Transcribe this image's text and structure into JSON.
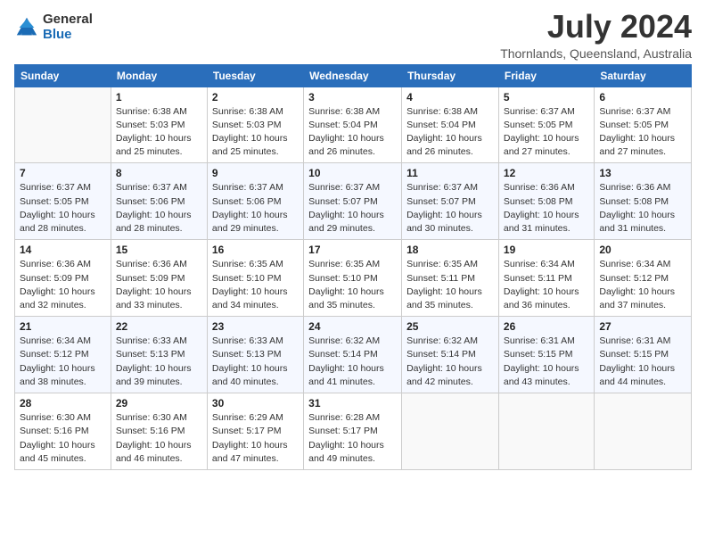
{
  "header": {
    "logo_general": "General",
    "logo_blue": "Blue",
    "month_title": "July 2024",
    "location": "Thornlands, Queensland, Australia"
  },
  "days_of_week": [
    "Sunday",
    "Monday",
    "Tuesday",
    "Wednesday",
    "Thursday",
    "Friday",
    "Saturday"
  ],
  "weeks": [
    [
      {
        "day": "",
        "info": ""
      },
      {
        "day": "1",
        "info": "Sunrise: 6:38 AM\nSunset: 5:03 PM\nDaylight: 10 hours\nand 25 minutes."
      },
      {
        "day": "2",
        "info": "Sunrise: 6:38 AM\nSunset: 5:03 PM\nDaylight: 10 hours\nand 25 minutes."
      },
      {
        "day": "3",
        "info": "Sunrise: 6:38 AM\nSunset: 5:04 PM\nDaylight: 10 hours\nand 26 minutes."
      },
      {
        "day": "4",
        "info": "Sunrise: 6:38 AM\nSunset: 5:04 PM\nDaylight: 10 hours\nand 26 minutes."
      },
      {
        "day": "5",
        "info": "Sunrise: 6:37 AM\nSunset: 5:05 PM\nDaylight: 10 hours\nand 27 minutes."
      },
      {
        "day": "6",
        "info": "Sunrise: 6:37 AM\nSunset: 5:05 PM\nDaylight: 10 hours\nand 27 minutes."
      }
    ],
    [
      {
        "day": "7",
        "info": "Sunrise: 6:37 AM\nSunset: 5:05 PM\nDaylight: 10 hours\nand 28 minutes."
      },
      {
        "day": "8",
        "info": "Sunrise: 6:37 AM\nSunset: 5:06 PM\nDaylight: 10 hours\nand 28 minutes."
      },
      {
        "day": "9",
        "info": "Sunrise: 6:37 AM\nSunset: 5:06 PM\nDaylight: 10 hours\nand 29 minutes."
      },
      {
        "day": "10",
        "info": "Sunrise: 6:37 AM\nSunset: 5:07 PM\nDaylight: 10 hours\nand 29 minutes."
      },
      {
        "day": "11",
        "info": "Sunrise: 6:37 AM\nSunset: 5:07 PM\nDaylight: 10 hours\nand 30 minutes."
      },
      {
        "day": "12",
        "info": "Sunrise: 6:36 AM\nSunset: 5:08 PM\nDaylight: 10 hours\nand 31 minutes."
      },
      {
        "day": "13",
        "info": "Sunrise: 6:36 AM\nSunset: 5:08 PM\nDaylight: 10 hours\nand 31 minutes."
      }
    ],
    [
      {
        "day": "14",
        "info": "Sunrise: 6:36 AM\nSunset: 5:09 PM\nDaylight: 10 hours\nand 32 minutes."
      },
      {
        "day": "15",
        "info": "Sunrise: 6:36 AM\nSunset: 5:09 PM\nDaylight: 10 hours\nand 33 minutes."
      },
      {
        "day": "16",
        "info": "Sunrise: 6:35 AM\nSunset: 5:10 PM\nDaylight: 10 hours\nand 34 minutes."
      },
      {
        "day": "17",
        "info": "Sunrise: 6:35 AM\nSunset: 5:10 PM\nDaylight: 10 hours\nand 35 minutes."
      },
      {
        "day": "18",
        "info": "Sunrise: 6:35 AM\nSunset: 5:11 PM\nDaylight: 10 hours\nand 35 minutes."
      },
      {
        "day": "19",
        "info": "Sunrise: 6:34 AM\nSunset: 5:11 PM\nDaylight: 10 hours\nand 36 minutes."
      },
      {
        "day": "20",
        "info": "Sunrise: 6:34 AM\nSunset: 5:12 PM\nDaylight: 10 hours\nand 37 minutes."
      }
    ],
    [
      {
        "day": "21",
        "info": "Sunrise: 6:34 AM\nSunset: 5:12 PM\nDaylight: 10 hours\nand 38 minutes."
      },
      {
        "day": "22",
        "info": "Sunrise: 6:33 AM\nSunset: 5:13 PM\nDaylight: 10 hours\nand 39 minutes."
      },
      {
        "day": "23",
        "info": "Sunrise: 6:33 AM\nSunset: 5:13 PM\nDaylight: 10 hours\nand 40 minutes."
      },
      {
        "day": "24",
        "info": "Sunrise: 6:32 AM\nSunset: 5:14 PM\nDaylight: 10 hours\nand 41 minutes."
      },
      {
        "day": "25",
        "info": "Sunrise: 6:32 AM\nSunset: 5:14 PM\nDaylight: 10 hours\nand 42 minutes."
      },
      {
        "day": "26",
        "info": "Sunrise: 6:31 AM\nSunset: 5:15 PM\nDaylight: 10 hours\nand 43 minutes."
      },
      {
        "day": "27",
        "info": "Sunrise: 6:31 AM\nSunset: 5:15 PM\nDaylight: 10 hours\nand 44 minutes."
      }
    ],
    [
      {
        "day": "28",
        "info": "Sunrise: 6:30 AM\nSunset: 5:16 PM\nDaylight: 10 hours\nand 45 minutes."
      },
      {
        "day": "29",
        "info": "Sunrise: 6:30 AM\nSunset: 5:16 PM\nDaylight: 10 hours\nand 46 minutes."
      },
      {
        "day": "30",
        "info": "Sunrise: 6:29 AM\nSunset: 5:17 PM\nDaylight: 10 hours\nand 47 minutes."
      },
      {
        "day": "31",
        "info": "Sunrise: 6:28 AM\nSunset: 5:17 PM\nDaylight: 10 hours\nand 49 minutes."
      },
      {
        "day": "",
        "info": ""
      },
      {
        "day": "",
        "info": ""
      },
      {
        "day": "",
        "info": ""
      }
    ]
  ]
}
